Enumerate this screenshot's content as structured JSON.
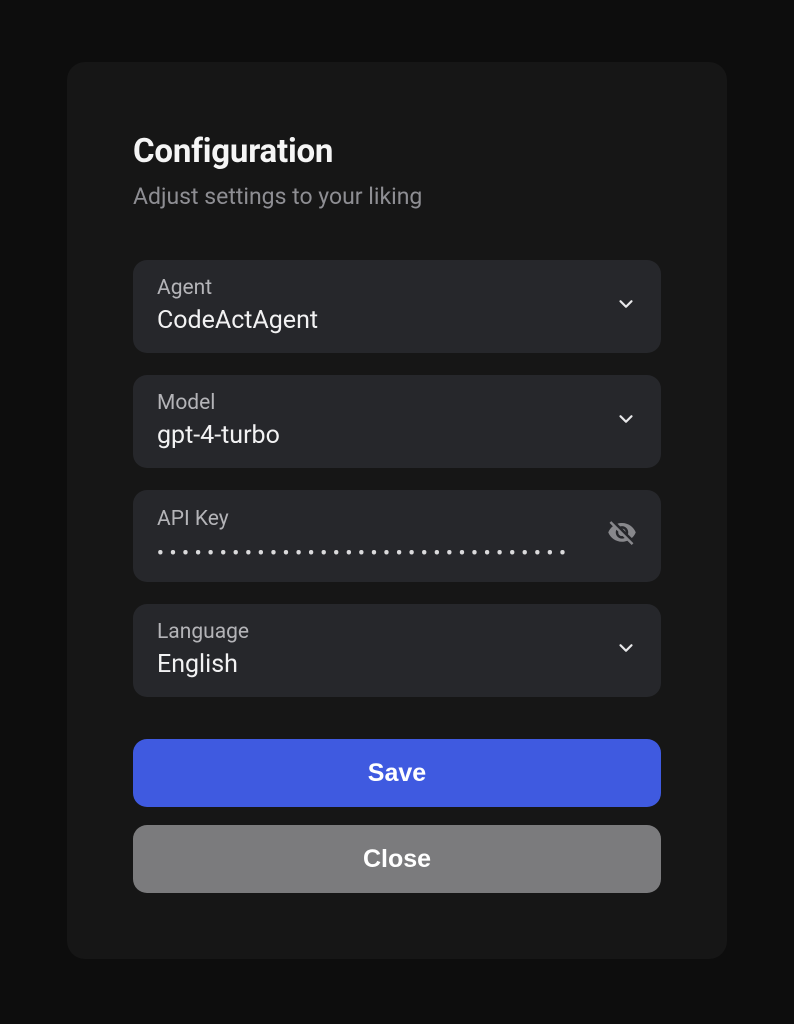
{
  "header": {
    "title": "Configuration",
    "subtitle": "Adjust settings to your liking"
  },
  "fields": {
    "agent": {
      "label": "Agent",
      "value": "CodeActAgent"
    },
    "model": {
      "label": "Model",
      "value": "gpt-4-turbo"
    },
    "apikey": {
      "label": "API Key",
      "value": "•••••••••••••••••••••••••••••••••"
    },
    "language": {
      "label": "Language",
      "value": "English"
    }
  },
  "buttons": {
    "save": "Save",
    "close": "Close"
  },
  "colors": {
    "accent": "#3f5ae0",
    "secondary": "#7b7b7d",
    "panel": "#161616",
    "field": "#26272b"
  }
}
